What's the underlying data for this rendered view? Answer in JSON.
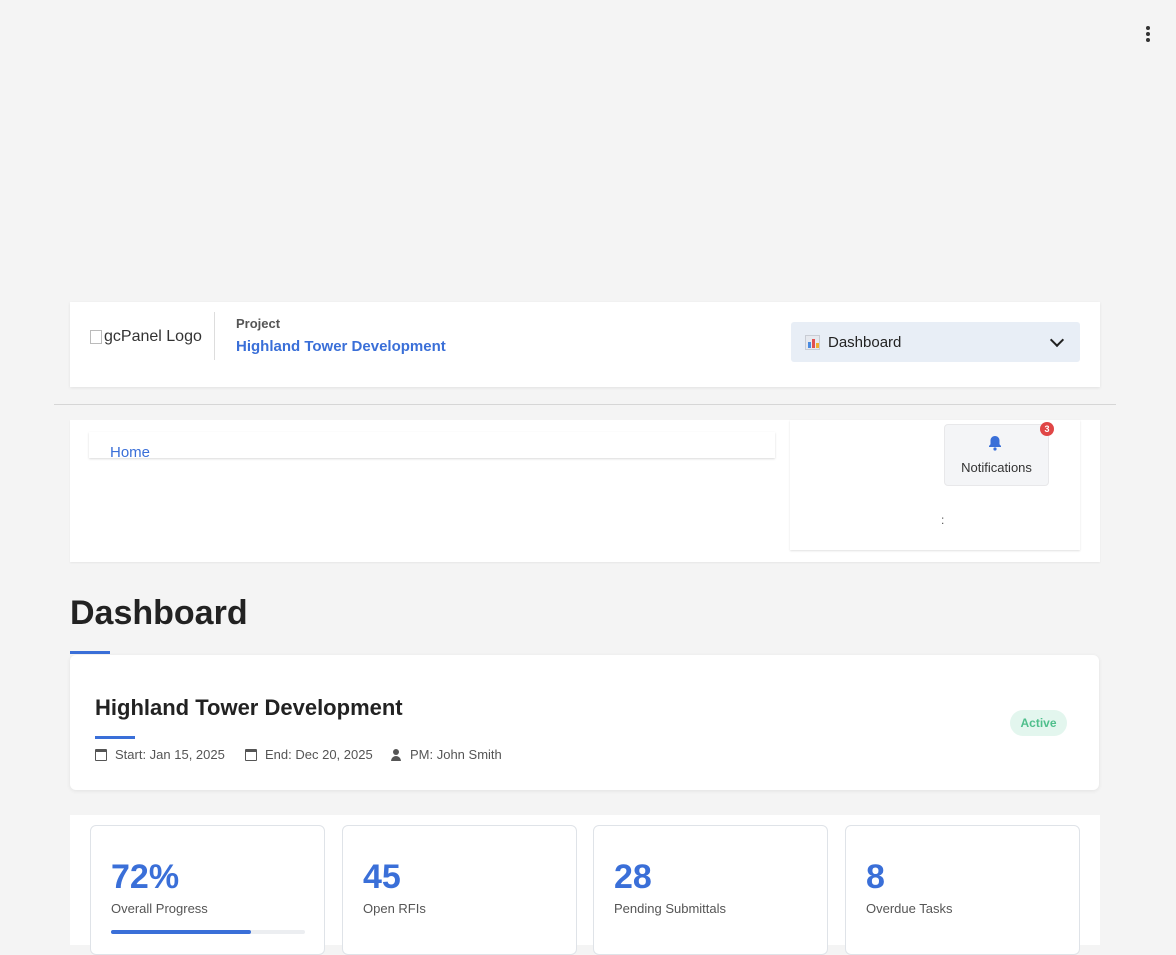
{
  "header": {
    "logo_alt": "gcPanel Logo",
    "project_label": "Project",
    "project_name": "Highland Tower Development",
    "nav_selected": "Dashboard",
    "nav_icon": "bar-chart-icon"
  },
  "toolbar": {
    "breadcrumb_home": "Home",
    "notifications_label": "Notifications",
    "notifications_count": "3",
    "colon_text": ":"
  },
  "page": {
    "title": "Dashboard"
  },
  "project_card": {
    "name": "Highland Tower Development",
    "start": "Start: Jan 15, 2025",
    "end": "End: Dec 20, 2025",
    "pm": "PM: John Smith",
    "status": "Active"
  },
  "stats": {
    "progress_value": "72%",
    "progress_label": "Overall Progress",
    "progress_fraction": 0.72,
    "rfis_value": "45",
    "rfis_label": "Open RFIs",
    "submittals_value": "28",
    "submittals_label": "Pending Submittals",
    "overdue_value": "8",
    "overdue_label": "Overdue Tasks"
  },
  "colors": {
    "accent": "#3a6fd8",
    "badge": "#e04646",
    "status_green": "#4fbf8c"
  }
}
